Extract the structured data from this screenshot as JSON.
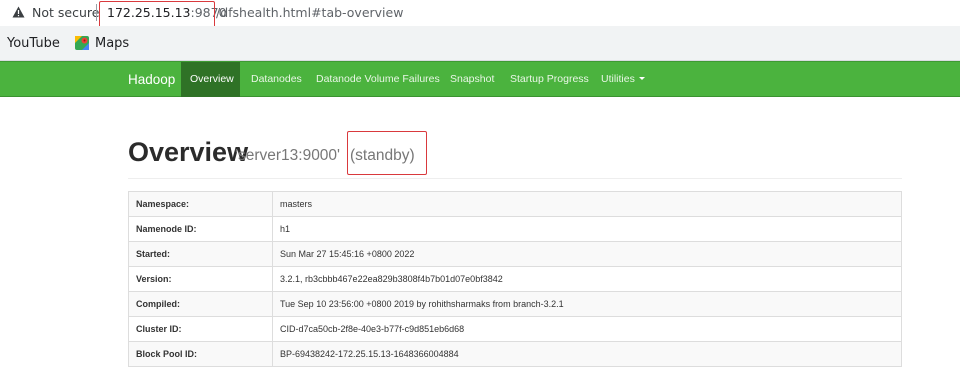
{
  "browser": {
    "security_label": "Not secure",
    "url_host": "172.25.15.13",
    "url_port": ":9870",
    "url_path": "/dfshealth.html#tab-overview",
    "warning_icon": "warning-triangle-icon"
  },
  "bookmarks": {
    "items": [
      {
        "label": "YouTube"
      },
      {
        "label": "Maps",
        "icon": "maps-icon"
      }
    ]
  },
  "navbar": {
    "brand": "Hadoop",
    "color": "#4bb33e",
    "active_color": "#2f7226",
    "items": [
      {
        "label": "Overview",
        "active": true
      },
      {
        "label": "Datanodes"
      },
      {
        "label": "Datanode Volume Failures"
      },
      {
        "label": "Snapshot"
      },
      {
        "label": "Startup Progress"
      },
      {
        "label": "Utilities",
        "dropdown": true
      }
    ]
  },
  "header": {
    "title": "Overview",
    "server": "'server13:9000'",
    "state": "(standby)"
  },
  "info": {
    "rows": [
      {
        "key": "Namespace:",
        "value": "masters"
      },
      {
        "key": "Namenode ID:",
        "value": "h1"
      },
      {
        "key": "Started:",
        "value": "Sun Mar 27 15:45:16 +0800 2022"
      },
      {
        "key": "Version:",
        "value": "3.2.1, rb3cbbb467e22ea829b3808f4b7b01d07e0bf3842"
      },
      {
        "key": "Compiled:",
        "value": "Tue Sep 10 23:56:00 +0800 2019 by rohithsharmaks from branch-3.2.1"
      },
      {
        "key": "Cluster ID:",
        "value": "CID-d7ca50cb-2f8e-40e3-b77f-c9d851eb6d68"
      },
      {
        "key": "Block Pool ID:",
        "value": "BP-69438242-172.25.15.13-1648366004884"
      }
    ]
  },
  "annotations": {
    "highlight_color": "#d9393d"
  }
}
